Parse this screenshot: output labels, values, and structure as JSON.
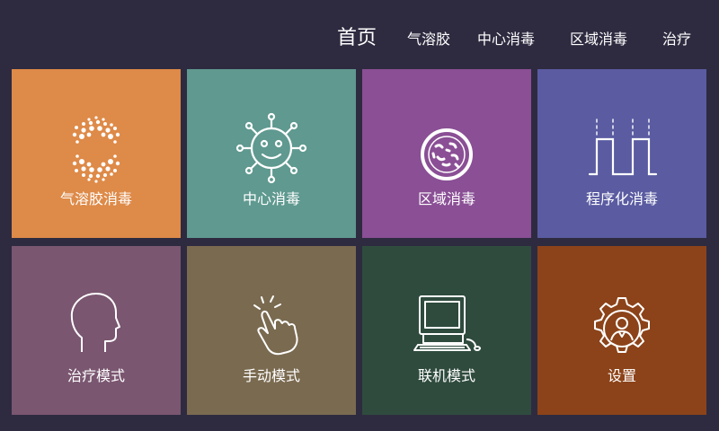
{
  "nav": {
    "home": "首页",
    "items": [
      "气溶胶",
      "中心消毒",
      "区域消毒",
      "治疗"
    ]
  },
  "tiles": [
    {
      "label": "气溶胶消毒",
      "icon": "aerosol-icon",
      "color": "#de8a48"
    },
    {
      "label": "中心消毒",
      "icon": "virus-icon",
      "color": "#5f9990"
    },
    {
      "label": "区域消毒",
      "icon": "bacteria-petri-icon",
      "color": "#8a4f95"
    },
    {
      "label": "程序化消毒",
      "icon": "pulse-wave-icon",
      "color": "#5a5ba1"
    },
    {
      "label": "治疗模式",
      "icon": "head-profile-icon",
      "color": "#7a5670"
    },
    {
      "label": "手动模式",
      "icon": "tap-hand-icon",
      "color": "#7a6a50"
    },
    {
      "label": "联机模式",
      "icon": "computer-icon",
      "color": "#2f4b3e"
    },
    {
      "label": "设置",
      "icon": "gear-person-icon",
      "color": "#8c4319"
    }
  ]
}
